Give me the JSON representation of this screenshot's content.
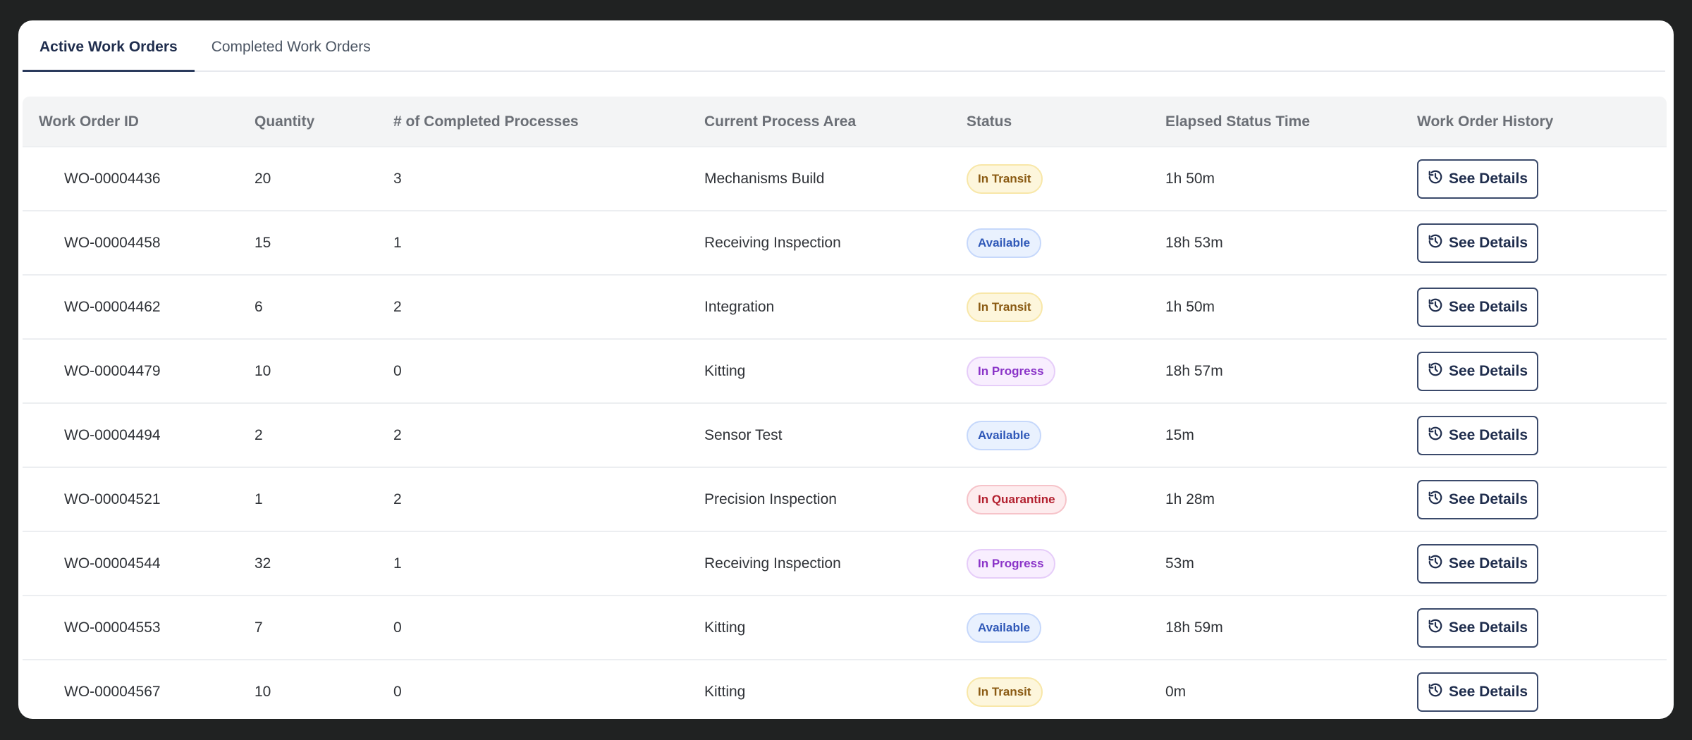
{
  "tabs": [
    {
      "label": "Active Work Orders",
      "active": true
    },
    {
      "label": "Completed Work Orders",
      "active": false
    }
  ],
  "columns": [
    "Work Order ID",
    "Quantity",
    "# of Completed Processes",
    "Current Process Area",
    "Status",
    "Elapsed Status Time",
    "Work Order History"
  ],
  "button_label": "See Details",
  "status_colors": {
    "In Transit": "#8a5a12",
    "Available": "#2f58b8",
    "In Progress": "#8a33c8",
    "In Quarantine": "#b3202f"
  },
  "rows": [
    {
      "id": "WO-00004436",
      "qty": "20",
      "completed": "3",
      "area": "Mechanisms Build",
      "status": "In Transit",
      "elapsed": "1h 50m"
    },
    {
      "id": "WO-00004458",
      "qty": "15",
      "completed": "1",
      "area": "Receiving Inspection",
      "status": "Available",
      "elapsed": "18h 53m"
    },
    {
      "id": "WO-00004462",
      "qty": "6",
      "completed": "2",
      "area": "Integration",
      "status": "In Transit",
      "elapsed": "1h 50m"
    },
    {
      "id": "WO-00004479",
      "qty": "10",
      "completed": "0",
      "area": "Kitting",
      "status": "In Progress",
      "elapsed": "18h 57m"
    },
    {
      "id": "WO-00004494",
      "qty": "2",
      "completed": "2",
      "area": "Sensor Test",
      "status": "Available",
      "elapsed": "15m"
    },
    {
      "id": "WO-00004521",
      "qty": "1",
      "completed": "2",
      "area": "Precision Inspection",
      "status": "In Quarantine",
      "elapsed": "1h 28m"
    },
    {
      "id": "WO-00004544",
      "qty": "32",
      "completed": "1",
      "area": "Receiving Inspection",
      "status": "In Progress",
      "elapsed": "53m"
    },
    {
      "id": "WO-00004553",
      "qty": "7",
      "completed": "0",
      "area": "Kitting",
      "status": "Available",
      "elapsed": "18h 59m"
    },
    {
      "id": "WO-00004567",
      "qty": "10",
      "completed": "0",
      "area": "Kitting",
      "status": "In Transit",
      "elapsed": "0m"
    }
  ]
}
